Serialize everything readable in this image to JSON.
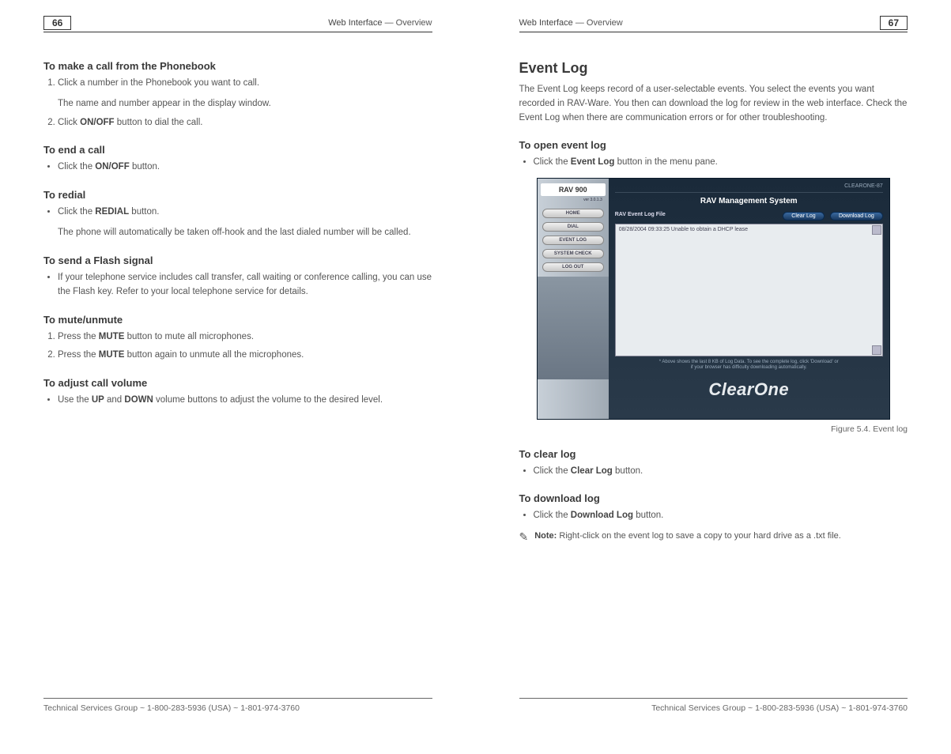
{
  "left": {
    "pageNum": "66",
    "headerBold": "Web Interface",
    "headerRest": " — Overview",
    "s1": {
      "title": "To make a call from the Phonebook",
      "li1": "Click a number in the Phonebook you want to call.",
      "li1b": "The name and number appear in the display window.",
      "li2a": "Click ",
      "li2b": "ON/OFF",
      "li2c": " button to dial the call."
    },
    "s2": {
      "title": "To end a call",
      "li1a": "Click the ",
      "li1b": "ON/OFF",
      "li1c": " button."
    },
    "s3": {
      "title": "To redial",
      "li1a": "Click the ",
      "li1b": "REDIAL",
      "li1c": " button.",
      "li1d": "The phone will automatically be taken off-hook and the last dialed number will be called."
    },
    "s4": {
      "title": "To send a Flash signal",
      "li1": "If your telephone service includes call transfer, call waiting or conference calling, you can use the Flash key. Refer to your local telephone service for details."
    },
    "s5": {
      "title": "To mute/unmute",
      "li1a": "Press the ",
      "li1b": "MUTE",
      "li1c": " button to mute all microphones.",
      "li2a": "Press the ",
      "li2b": "MUTE",
      "li2c": " button again to unmute all the microphones."
    },
    "s6": {
      "title": "To adjust call volume",
      "li1a": "Use the ",
      "li1b": "UP",
      "li1c": " and ",
      "li1d": "DOWN",
      "li1e": " volume buttons to adjust the volume to the desired level."
    },
    "footer": "Technical Services Group ~ 1-800-283-5936 (USA) ~ 1-801-974-3760"
  },
  "right": {
    "pageNum": "67",
    "headerBold": "Web Interface",
    "headerRest": " — Overview",
    "h2": "Event Log",
    "intro": "The Event Log keeps record of a user-selectable events. You select the events you want recorded in RAV-Ware. You then can download the log for review in the web interface. Check the Event Log when there are communication errors or for other troubleshooting.",
    "s1": {
      "title": "To open event log",
      "li1a": "Click the ",
      "li1b": "Event Log",
      "li1c": " button in the menu pane."
    },
    "caption": "Figure 5.4. Event log",
    "s2": {
      "title": "To clear log",
      "li1a": "Click the ",
      "li1b": "Clear Log",
      "li1c": " button."
    },
    "s3": {
      "title": "To download log",
      "li1a": "Click the ",
      "li1b": "Download Log",
      "li1c": " button."
    },
    "noteLabel": "Note:",
    "noteText": "  Right-click on the event log to save a copy to your hard drive as a .txt file.",
    "footer": "Technical Services Group ~ 1-800-283-5936 (USA) ~ 1-801-974-3760"
  },
  "screenshot": {
    "deviceLogo": "RAV 900",
    "deviceSub": "ver 3.0.1.3",
    "nav": {
      "home": "HOME",
      "dial": "DIAL",
      "eventlog": "EVENT LOG",
      "syscheck": "SYSTEM CHECK",
      "logout": "LOG OUT"
    },
    "corner": "CLEARONE-87",
    "title": "RAV Management System",
    "subLabel": "RAV Event Log File",
    "clearBtn": "Clear Log",
    "dlBtn": "Download Log",
    "logLine": "08/28/2004 09:33:25    Unable to obtain a DHCP lease",
    "footNote1": "* Above shows the last 8 KB of Log Data. To see the complete log, click 'Download' or",
    "footNote2": "if your browser has difficulty downloading automatically.",
    "brand": "ClearOne"
  }
}
